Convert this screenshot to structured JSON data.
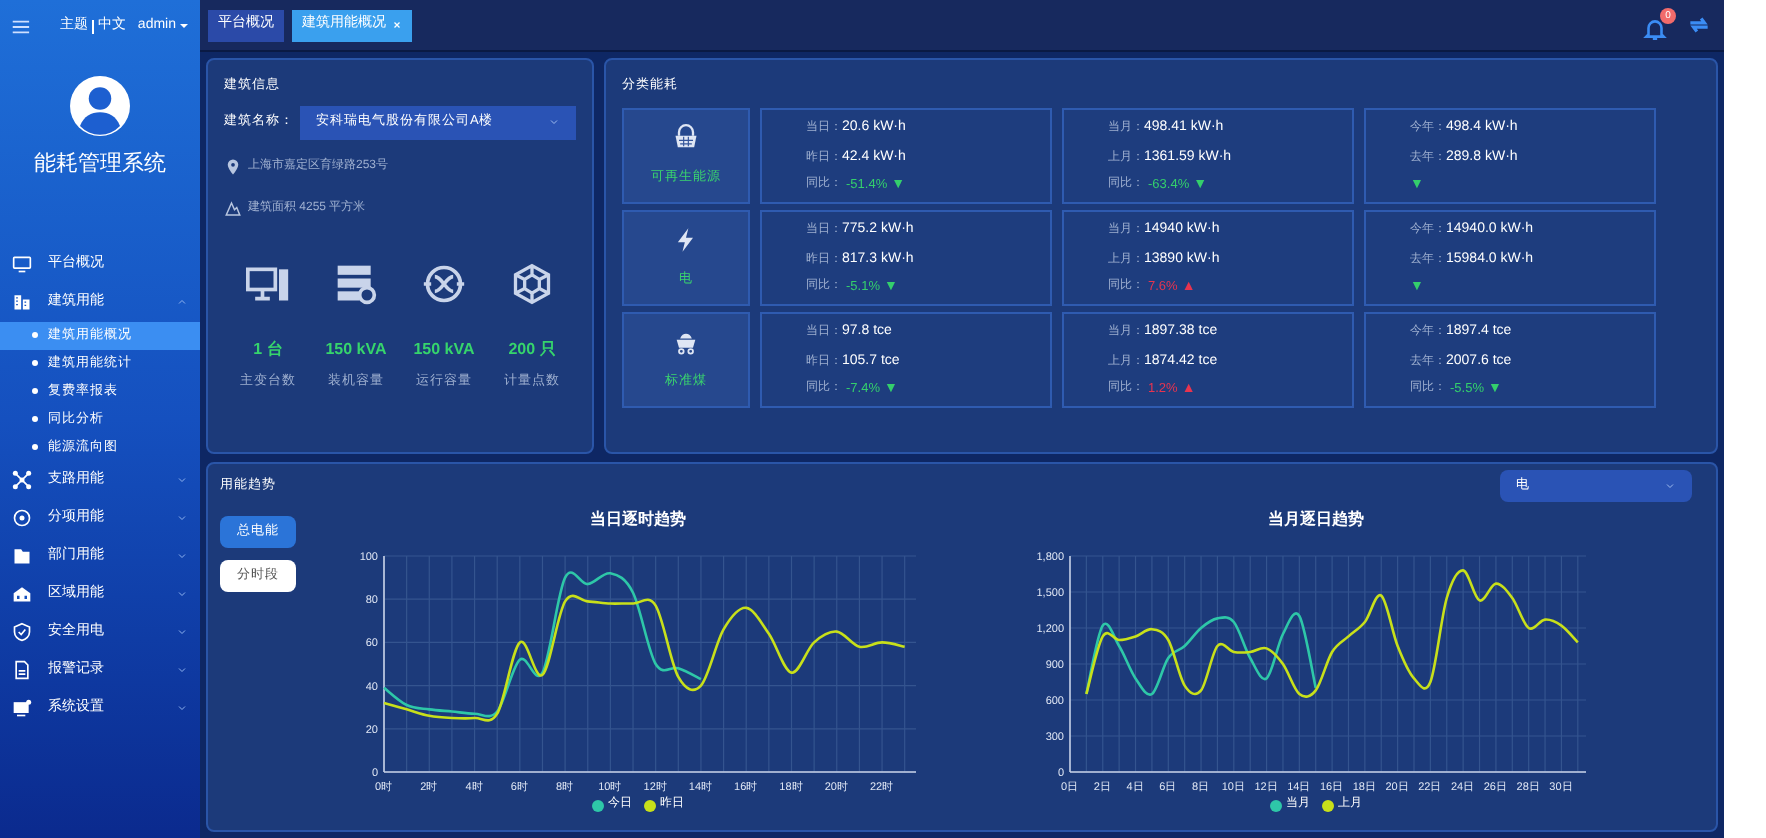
{
  "header": {
    "links": [
      "主题",
      "中文"
    ],
    "user": "admin"
  },
  "tabs": [
    {
      "label": "平台概况",
      "selected": false
    },
    {
      "label": "建筑用能概况",
      "selected": true
    }
  ],
  "notifications": {
    "badge": "0"
  },
  "sidebar": {
    "title": "能耗管理系统",
    "items": [
      {
        "label": "平台概况",
        "selected": false
      },
      {
        "label": "建筑用能",
        "selected": false,
        "expanded": true,
        "children": [
          {
            "label": "建筑用能概况",
            "selected": true
          },
          {
            "label": "建筑用能统计",
            "selected": false
          },
          {
            "label": "复费率报表",
            "selected": false
          },
          {
            "label": "同比分析",
            "selected": false
          },
          {
            "label": "能源流向图",
            "selected": false
          }
        ]
      },
      {
        "label": "支路用能",
        "selected": false,
        "expanded": false
      },
      {
        "label": "分项用能",
        "selected": false,
        "expanded": false
      },
      {
        "label": "部门用能",
        "selected": false,
        "expanded": false
      },
      {
        "label": "区域用能",
        "selected": false,
        "expanded": false
      },
      {
        "label": "安全用电",
        "selected": false,
        "expanded": false
      },
      {
        "label": "报警记录",
        "selected": false,
        "expanded": false
      },
      {
        "label": "系统设置",
        "selected": false,
        "expanded": false
      }
    ]
  },
  "building_info": {
    "title": "建筑信息",
    "name_label": "建筑名称：",
    "name_value": "安科瑞电气股份有限公司A楼",
    "address": "上海市嘉定区育绿路253号",
    "area": "建筑面积 4255 平方米",
    "stats": [
      {
        "value": "1 台",
        "label": "主变台数"
      },
      {
        "value": "150 kVA",
        "label": "装机容量"
      },
      {
        "value": "150 kVA",
        "label": "运行容量"
      },
      {
        "value": "200 只",
        "label": "计量点数"
      }
    ]
  },
  "category_energy": {
    "title": "分类能耗",
    "rows": [
      {
        "name": "可再生能源",
        "groups": [
          {
            "current_label": "当日：",
            "current": "20.6 kW·h",
            "previous_label": "昨日：",
            "previous": "42.4 kW·h",
            "change_label": "同比：",
            "change": "-51.4%",
            "arrow": "▼",
            "increase": false
          },
          {
            "current_label": "当月：",
            "current": "498.41 kW·h",
            "previous_label": "上月：",
            "previous": "1361.59 kW·h",
            "change_label": "同比：",
            "change": "-63.4%",
            "arrow": "▼",
            "increase": false
          },
          {
            "current_label": "今年：",
            "current": "498.4 kW·h",
            "previous_label": "去年：",
            "previous": "289.8 kW·h",
            "arrow": "▼",
            "increase": false
          }
        ]
      },
      {
        "name": "电",
        "groups": [
          {
            "current_label": "当日：",
            "current": "775.2 kW·h",
            "previous_label": "昨日：",
            "previous": "817.3 kW·h",
            "change_label": "同比：",
            "change": "-5.1%",
            "arrow": "▼",
            "increase": false
          },
          {
            "current_label": "当月：",
            "current": "14940 kW·h",
            "previous_label": "上月：",
            "previous": "13890 kW·h",
            "change_label": "同比：",
            "change": "7.6%",
            "arrow": "▲",
            "increase": true
          },
          {
            "current_label": "今年：",
            "current": "14940.0 kW·h",
            "previous_label": "去年：",
            "previous": "15984.0 kW·h",
            "arrow": "▼",
            "increase": false
          }
        ]
      },
      {
        "name": "标准煤",
        "groups": [
          {
            "current_label": "当日：",
            "current": "97.8 tce",
            "previous_label": "昨日：",
            "previous": "105.7 tce",
            "change_label": "同比：",
            "change": "-7.4%",
            "arrow": "▼",
            "increase": false
          },
          {
            "current_label": "当月：",
            "current": "1897.38 tce",
            "previous_label": "上月：",
            "previous": "1874.42 tce",
            "change_label": "同比：",
            "change": "1.2%",
            "arrow": "▲",
            "increase": true
          },
          {
            "current_label": "今年：",
            "current": "1897.4 tce",
            "previous_label": "去年：",
            "previous": "2007.6 tce",
            "change_label": "同比：",
            "change": "-5.5%",
            "arrow": "▼",
            "increase": false
          }
        ]
      }
    ]
  },
  "trend": {
    "title": "用能趋势",
    "modes": [
      {
        "label": "总电能",
        "selected": true
      },
      {
        "label": "分时段",
        "selected": false
      }
    ],
    "energy_select": "电",
    "charts": [
      {
        "chart_data": {
          "type": "line",
          "title": "当日逐时趋势",
          "xlim": [
            0,
            23.5
          ],
          "grid": true,
          "legend": true,
          "x": [
            0,
            1,
            2,
            3,
            4,
            5,
            6,
            7,
            8,
            9,
            10,
            11,
            12,
            13,
            14,
            15,
            16,
            17,
            18,
            19,
            20,
            21,
            22,
            23
          ],
          "xticks": [
            {
              "value": 0,
              "label": "0时"
            },
            {
              "value": 2,
              "label": "2时"
            },
            {
              "value": 4,
              "label": "4时"
            },
            {
              "value": 6,
              "label": "6时"
            },
            {
              "value": 8,
              "label": "8时"
            },
            {
              "value": 10,
              "label": "10时"
            },
            {
              "value": 12,
              "label": "12时"
            },
            {
              "value": 14,
              "label": "14时"
            },
            {
              "value": 16,
              "label": "16时"
            },
            {
              "value": 18,
              "label": "18时"
            },
            {
              "value": 20,
              "label": "20时"
            },
            {
              "value": 22,
              "label": "22时"
            }
          ],
          "ylim": [
            0,
            100
          ],
          "yticks": [
            0,
            20,
            40,
            60,
            80,
            100
          ],
          "series": [
            {
              "name": "今日",
              "color": "#2ec7a8",
              "values": [
                39,
                31,
                29,
                28,
                27,
                28,
                52,
                46,
                90,
                87,
                92,
                83,
                50,
                48,
                43,
                null,
                null,
                null,
                null,
                null,
                null,
                null,
                null,
                null
              ]
            },
            {
              "name": "昨日",
              "color": "#c8e01a",
              "values": [
                32,
                29,
                26,
                25,
                25,
                27,
                60,
                45,
                79,
                79,
                78,
                78,
                77,
                44,
                40,
                66,
                76,
                64,
                46,
                60,
                65,
                58,
                60,
                58
              ]
            }
          ]
        }
      },
      {
        "chart_data": {
          "type": "line",
          "title": "当月逐日趋势",
          "xlim": [
            0,
            31.5
          ],
          "grid": true,
          "legend": true,
          "x": [
            1,
            2,
            3,
            4,
            5,
            6,
            7,
            8,
            9,
            10,
            11,
            12,
            13,
            14,
            15,
            16,
            17,
            18,
            19,
            20,
            21,
            22,
            23,
            24,
            25,
            26,
            27,
            28,
            29,
            30,
            31
          ],
          "xticks": [
            {
              "value": 0,
              "label": "0日"
            },
            {
              "value": 2,
              "label": "2日"
            },
            {
              "value": 4,
              "label": "4日"
            },
            {
              "value": 6,
              "label": "6日"
            },
            {
              "value": 8,
              "label": "8日"
            },
            {
              "value": 10,
              "label": "10日"
            },
            {
              "value": 12,
              "label": "12日"
            },
            {
              "value": 14,
              "label": "14日"
            },
            {
              "value": 16,
              "label": "16日"
            },
            {
              "value": 18,
              "label": "18日"
            },
            {
              "value": 20,
              "label": "20日"
            },
            {
              "value": 22,
              "label": "22日"
            },
            {
              "value": 24,
              "label": "24日"
            },
            {
              "value": 26,
              "label": "26日"
            },
            {
              "value": 28,
              "label": "28日"
            },
            {
              "value": 30,
              "label": "30日"
            }
          ],
          "ylim": [
            0,
            1800
          ],
          "yticks": [
            {
              "value": 0,
              "label": "0"
            },
            {
              "value": 300,
              "label": "300"
            },
            {
              "value": 600,
              "label": "600"
            },
            {
              "value": 900,
              "label": "900"
            },
            {
              "value": 1200,
              "label": "1,200"
            },
            {
              "value": 1500,
              "label": "1,500"
            },
            {
              "value": 1800,
              "label": "1,800"
            }
          ],
          "series": [
            {
              "name": "当月",
              "color": "#2ec7a8",
              "values": [
                650,
                1220,
                1050,
                780,
                650,
                950,
                1050,
                1200,
                1280,
                1250,
                950,
                780,
                1150,
                1300,
                700,
                null,
                null,
                null,
                null,
                null,
                null,
                null,
                null,
                null,
                null,
                null,
                null,
                null,
                null,
                null,
                null
              ]
            },
            {
              "name": "上月",
              "color": "#c8e01a",
              "values": [
                650,
                1130,
                1100,
                1130,
                1190,
                1100,
                720,
                680,
                1050,
                1000,
                1000,
                1030,
                900,
                650,
                680,
                1000,
                1130,
                1250,
                1470,
                1050,
                780,
                750,
                1450,
                1680,
                1430,
                1570,
                1450,
                1200,
                1270,
                1220,
                1080
              ]
            }
          ]
        }
      }
    ]
  }
}
